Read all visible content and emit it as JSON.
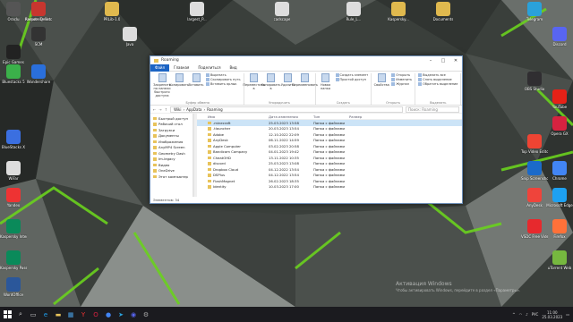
{
  "desktop_icons": [
    {
      "label": "Oraclu",
      "icon": "app-icon",
      "color": "#555"
    },
    {
      "label": "Kaspersky Sec.",
      "icon": "kaspersky-icon",
      "color": "#0a8a5a"
    },
    {
      "label": "Remote Desktop",
      "icon": "remote-icon",
      "color": "#c7362f"
    },
    {
      "label": "PRLib-1.0",
      "icon": "folder-icon",
      "color": "#e0b94e"
    },
    {
      "label": "largest_P...",
      "icon": "doc-icon",
      "color": "#ddd"
    },
    {
      "label": "cadscape",
      "icon": "cad-icon",
      "color": "#ddd"
    },
    {
      "label": "Rule_L...",
      "icon": "doc-icon",
      "color": "#ddd"
    },
    {
      "label": "Kaspersky...",
      "icon": "folder-icon",
      "color": "#e0b94e"
    },
    {
      "label": "Documents",
      "icon": "folder-icon",
      "color": "#e0b94e"
    },
    {
      "label": "Telegram",
      "icon": "telegram-icon",
      "color": "#2aa1da"
    },
    {
      "label": "Discord",
      "icon": "discord-icon",
      "color": "#5865f2"
    },
    {
      "label": "SCM",
      "icon": "app-icon",
      "color": "#333"
    },
    {
      "label": "Java",
      "icon": "java-icon",
      "color": "#ddd"
    },
    {
      "label": "Epic Games",
      "icon": "epic-icon",
      "color": "#222"
    },
    {
      "label": "Bluestacks 5",
      "icon": "bluestacks-icon",
      "color": "#3bb04a"
    },
    {
      "label": "Wondershare",
      "icon": "ws-icon",
      "color": "#2a6fdb"
    },
    {
      "label": "BlueStacks X",
      "icon": "bluestacks-icon",
      "color": "#3b6fe0"
    },
    {
      "label": "WiFar",
      "icon": "wifi-icon",
      "color": "#ddd"
    },
    {
      "label": "Yandex",
      "icon": "yandex-icon",
      "color": "#e33"
    },
    {
      "label": "Kaspersky Internet",
      "icon": "kaspersky-icon",
      "color": "#0a8a5a"
    },
    {
      "label": "Kaspersky Password",
      "icon": "kaspersky-icon",
      "color": "#0a8a5a"
    },
    {
      "label": "WordOffice",
      "icon": "word-icon",
      "color": "#2b579a"
    },
    {
      "label": "OBS Studio",
      "icon": "obs-icon",
      "color": "#302e31"
    },
    {
      "label": "YouTube",
      "icon": "youtube-icon",
      "color": "#e62117"
    },
    {
      "label": "Opera GX",
      "icon": "opera-icon",
      "color": "#d62240"
    },
    {
      "label": "Top Video Editor",
      "icon": "video-icon",
      "color": "#e43"
    },
    {
      "label": "Chrome",
      "icon": "chrome-icon",
      "color": "#4285f4"
    },
    {
      "label": "Snip Screenshot",
      "icon": "snip-icon",
      "color": "#1b6ac9"
    },
    {
      "label": "Microsoft Edge",
      "icon": "edge-icon",
      "color": "#1da1f2"
    },
    {
      "label": "AnyDesk",
      "icon": "anydesk-icon",
      "color": "#ef443b"
    },
    {
      "label": "VSDC Free Video Editor",
      "icon": "vsdc-icon",
      "color": "#e7292d"
    },
    {
      "label": "Firefox",
      "icon": "firefox-icon",
      "color": "#ff7139"
    },
    {
      "label": "uTorrent Web",
      "icon": "utorrent-icon",
      "color": "#76b83f"
    }
  ],
  "window": {
    "title": "Roaming",
    "menu": [
      "Файл",
      "Главная",
      "Поделиться",
      "Вид"
    ],
    "ribbon_groups": [
      {
        "name": "Буфер обмена",
        "buttons": [
          "Закрепить на панели быстрого доступа",
          "Копировать",
          "Вставить"
        ],
        "list": [
          "Вырезать",
          "Скопировать путь",
          "Вставить ярлык"
        ]
      },
      {
        "name": "Упорядочить",
        "buttons": [
          "Переместить в",
          "Копировать в",
          "Удалить",
          "Переименовать"
        ],
        "list": []
      },
      {
        "name": "Создать",
        "buttons": [
          "Новая папка"
        ],
        "list": [
          "Создать элемент",
          "Простой доступ"
        ]
      },
      {
        "name": "Открыть",
        "buttons": [
          "Свойства"
        ],
        "list": [
          "Открыть",
          "Изменить",
          "Журнал"
        ]
      },
      {
        "name": "Выделить",
        "buttons": [],
        "list": [
          "Выделить все",
          "Снять выделение",
          "Обратить выделение"
        ]
      }
    ],
    "address": {
      "path": [
        "Wiki",
        "AppData",
        "Roaming"
      ],
      "search_placeholder": "Поиск: Roaming"
    },
    "nav_items": [
      {
        "label": "Быстрый доступ",
        "selected": false
      },
      {
        "label": "Рабочий стол",
        "selected": false
      },
      {
        "label": "Загрузки",
        "selected": false
      },
      {
        "label": "Документы",
        "selected": false
      },
      {
        "label": "Изображения",
        "selected": false
      },
      {
        "label": "AnyMP4 Screen",
        "selected": false
      },
      {
        "label": "Geometry Dash",
        "selected": false
      },
      {
        "label": "Im-legacy",
        "selected": false
      },
      {
        "label": "Видео",
        "selected": false
      },
      {
        "label": "OneDrive",
        "selected": false
      },
      {
        "label": "Этот компьютер",
        "selected": false
      }
    ],
    "columns": {
      "name": "Имя",
      "date": "Дата изменения",
      "type": "Тип",
      "size": "Размер"
    },
    "files": [
      {
        "name": ".minecraft",
        "date": "25.03.2023 13:58",
        "type": "Папка с файлами",
        "selected": true
      },
      {
        "name": ".tlauncher",
        "date": "20.03.2023 13:54",
        "type": "Папка с файлами",
        "selected": false
      },
      {
        "name": "Adobe",
        "date": "12.10.2022 22:09",
        "type": "Папка с файлами",
        "selected": false
      },
      {
        "name": "AnyDesk",
        "date": "06.11.2022 14:59",
        "type": "Папка с файлами",
        "selected": false
      },
      {
        "name": "Apple Computer",
        "date": "03.02.2023 20:58",
        "type": "Папка с файлами",
        "selected": false
      },
      {
        "name": "Bandicam Company",
        "date": "04.01.2023 19:42",
        "type": "Папка с файлами",
        "selected": false
      },
      {
        "name": "CheatOHD",
        "date": "13.11.2022 10:35",
        "type": "Папка с файлами",
        "selected": false
      },
      {
        "name": "discord",
        "date": "25.03.2023 13:08",
        "type": "Папка с файлами",
        "selected": false
      },
      {
        "name": "Dropbox Cloud",
        "date": "04.12.2022 13:54",
        "type": "Папка с файлами",
        "selected": false
      },
      {
        "name": "DSPlus",
        "date": "04.12.2022 13:54",
        "type": "Папка с файлами",
        "selected": false
      },
      {
        "name": "FlashMagnet",
        "date": "26.02.2023 18:35",
        "type": "Папка с файлами",
        "selected": false
      },
      {
        "name": "Identity",
        "date": "10.03.2023 17:00",
        "type": "Папка с файлами",
        "selected": false
      }
    ],
    "status": "Элементов: 34"
  },
  "watermark": {
    "line1": "Активация Windows",
    "line2": "Чтобы активировать Windows, перейдите в раздел «Параметры»."
  },
  "taskbar": {
    "apps": [
      "search-icon",
      "taskview-icon",
      "edge-icon",
      "explorer-icon",
      "store-icon",
      "yandex-icon",
      "opera-icon",
      "chrome-icon",
      "telegram-icon",
      "discord-icon",
      "settings-icon"
    ],
    "time": "11:00",
    "date": "25.03.2023",
    "lang": "РУС"
  }
}
